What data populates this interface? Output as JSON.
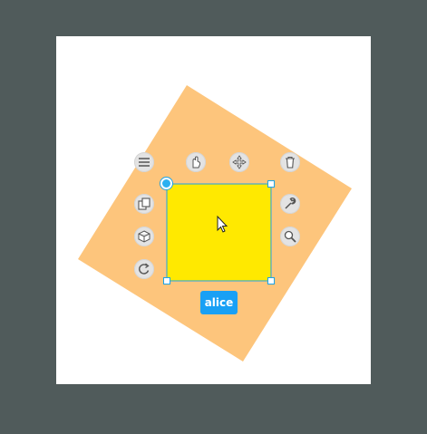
{
  "canvas": {
    "background": "#ffffff",
    "backdrop": "#505b5b"
  },
  "shapes": {
    "rotated_square_color": "#fdc57c",
    "selected_square_color": "#ffe900",
    "selection_color": "#1aa3e8"
  },
  "toolbar": {
    "icons": [
      "menu-icon",
      "hand-icon",
      "move-icon",
      "trash-icon",
      "duplicate-icon",
      "cube-icon",
      "rotate-icon",
      "wrench-icon",
      "zoom-icon"
    ]
  },
  "collaborator": {
    "name": "alice",
    "color": "#19a0f5"
  }
}
